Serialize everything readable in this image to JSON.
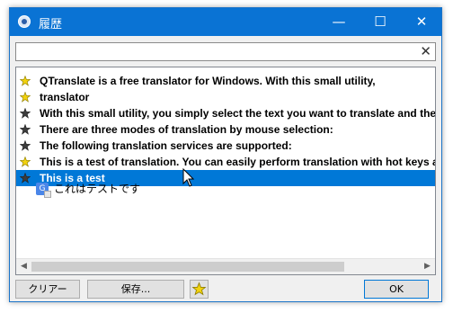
{
  "window": {
    "title": "履歴"
  },
  "titlebar": {
    "minimize": "—",
    "maximize": "☐",
    "close": "✕"
  },
  "search": {
    "value": "",
    "clear_glyph": "✕"
  },
  "colors": {
    "accent": "#0078d7",
    "star_favorite": "#f2d20e",
    "star_normal": "#3c3c3c"
  },
  "history": {
    "items": [
      {
        "text": "QTranslate is a free translator for Windows. With this small utility,",
        "favorite": true,
        "selected": false
      },
      {
        "text": "translator",
        "favorite": true,
        "selected": false
      },
      {
        "text": "With this small utility, you simply select the text you want to translate and then",
        "favorite": false,
        "selected": false
      },
      {
        "text": "There are three modes of translation by mouse selection:",
        "favorite": false,
        "selected": false
      },
      {
        "text": "The following translation services are supported:",
        "favorite": false,
        "selected": false
      },
      {
        "text": "This is a test of translation. You can easily perform translation with hot keys and",
        "favorite": true,
        "selected": false
      },
      {
        "text": "This is a test",
        "favorite": false,
        "selected": true
      }
    ],
    "translation": {
      "icon": "google-translate-icon",
      "text": "これはテストです"
    }
  },
  "buttons": {
    "clear": "クリアー",
    "save": "保存...",
    "ok": "OK"
  }
}
